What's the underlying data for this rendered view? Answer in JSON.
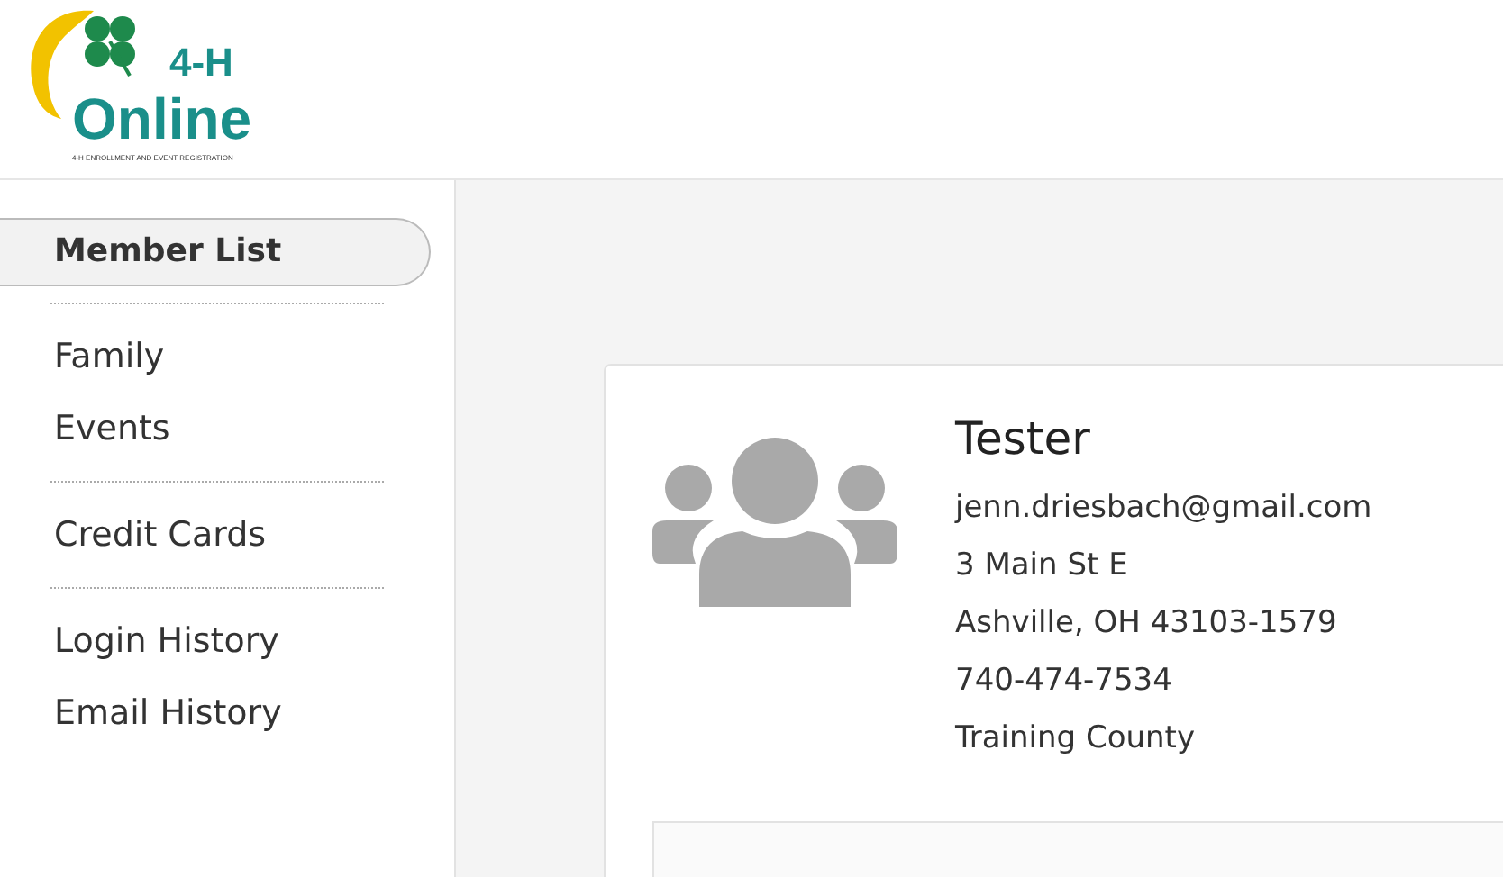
{
  "logo": {
    "mark": "4-H",
    "name": "Online",
    "tagline": "4-H ENROLLMENT AND EVENT REGISTRATION"
  },
  "sidebar": {
    "groups": [
      {
        "items": [
          {
            "label": "Member List",
            "selected": true
          }
        ]
      },
      {
        "items": [
          {
            "label": "Family",
            "selected": false
          },
          {
            "label": "Events",
            "selected": false
          }
        ]
      },
      {
        "items": [
          {
            "label": "Credit Cards",
            "selected": false
          }
        ]
      },
      {
        "items": [
          {
            "label": "Login History",
            "selected": false
          },
          {
            "label": "Email History",
            "selected": false
          }
        ]
      }
    ]
  },
  "profile": {
    "name": "Tester",
    "details": [
      "jenn.driesbach@gmail.com",
      "3 Main St E",
      "Ashville, OH 43103-1579",
      "740-474-7534",
      "Training County"
    ]
  }
}
